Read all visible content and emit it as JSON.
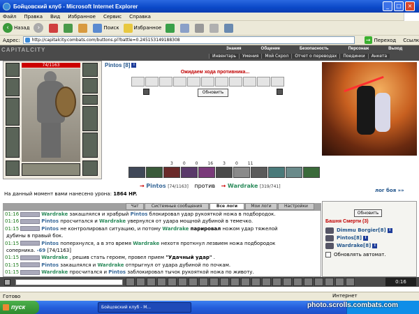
{
  "window": {
    "title": "Бойцовский клуб - Microsoft Internet Explorer"
  },
  "menu": [
    "Файл",
    "Правка",
    "Вид",
    "Избранное",
    "Сервис",
    "Справка"
  ],
  "toolbar": {
    "back": "Назад",
    "search": "Поиск",
    "favorites": "Избранное"
  },
  "address": {
    "label": "Адрес:",
    "url": "http://capitalcity.combats.com/buttons.pl?battle=0.245153149188308",
    "go": "Переход",
    "links": "Ссылки"
  },
  "site": {
    "logo": "CAPITALCITY",
    "topnav": [
      "Знания",
      "Общение",
      "Безопасность",
      "Персонаж",
      "Выход"
    ],
    "subnav": [
      "Инвентарь",
      "Умения",
      "Мой Скрол",
      "Отчет о переводах",
      "Поединки",
      "Анкета"
    ]
  },
  "player": {
    "name": "Pintos",
    "level": "[8]",
    "hp": "74/1163"
  },
  "battle": {
    "waiting": "Ожидаем хода противника...",
    "refresh": "Обновить",
    "stats": [
      "3",
      "0",
      "0",
      "16",
      "3",
      "0",
      "11"
    ],
    "p1_name": "Pintos",
    "p1_hp": "[74/1163]",
    "vs": "против",
    "p2_name": "Wardrake",
    "p2_hp": "[319/741]",
    "damage_label": "На данный момент вами нанесено урона:",
    "damage_value": "1864 HP.",
    "log_link": "лог боя »»"
  },
  "tabs": [
    "Чат",
    "Системные сообщения",
    "Все логи",
    "Мои логи",
    "Настройки"
  ],
  "chat": [
    {
      "time": "01:16",
      "parts": [
        [
          "wr",
          "Wardrake"
        ],
        [
          "",
          "закашлялся и храбрый"
        ],
        [
          "pn",
          "Pintos"
        ],
        [
          "",
          "блокировал удар рукояткой ножа в подбородок."
        ]
      ]
    },
    {
      "time": "01:16",
      "parts": [
        [
          "pn",
          "Pintos"
        ],
        [
          "",
          "просчитался и"
        ],
        [
          "wr",
          "Wardrake"
        ],
        [
          "",
          "увернулся от удара мощной дубиной в темечко."
        ]
      ]
    },
    {
      "time": "01:15",
      "parts": [
        [
          "pn",
          "Pintos"
        ],
        [
          "",
          "не контролировал ситуацию, и потому"
        ],
        [
          "wr",
          "Wardrake"
        ],
        [
          "b",
          "парировал"
        ],
        [
          "",
          "ножом удар тяжелой"
        ]
      ]
    },
    {
      "time": "",
      "parts": [
        [
          "",
          "дубины в правый бок."
        ]
      ]
    },
    {
      "time": "01:15",
      "parts": [
        [
          "pn",
          "Pintos"
        ],
        [
          "",
          "поперхнулся, а в это время"
        ],
        [
          "wr",
          "Wardrake"
        ],
        [
          "",
          "нехотя проткнул лезвием ножа подбородок"
        ]
      ]
    },
    {
      "time": "",
      "parts": [
        [
          "",
          "соперника."
        ],
        [
          "dmg",
          "-69"
        ],
        [
          "",
          "[74/1163]"
        ]
      ]
    },
    {
      "time": "01:15",
      "parts": [
        [
          "wr",
          "Wardrake"
        ],
        [
          "",
          ", решив стать героем, провел прием"
        ],
        [
          "b",
          "\"Удачный удар\""
        ],
        [
          "",
          "."
        ]
      ]
    },
    {
      "time": "01:15",
      "parts": [
        [
          "pn",
          "Pintos"
        ],
        [
          "",
          "закашлялся и"
        ],
        [
          "wr",
          "Wardrake"
        ],
        [
          "",
          "отпрыгнул от удара дубиной по почкам."
        ]
      ]
    },
    {
      "time": "01:15",
      "parts": [
        [
          "wr",
          "Wardrake"
        ],
        [
          "",
          "просчитался и"
        ],
        [
          "pn",
          "Pintos"
        ],
        [
          "",
          "заблокировал тычок рукояткой ножа по животу."
        ]
      ]
    }
  ],
  "sidebar": {
    "refresh": "Обновить",
    "tower": "Башня Смерти (3)",
    "players": [
      "Dimmu Borgier[8]",
      "Pintos[8]",
      "Wardrake[8]"
    ],
    "auto": "Обновлять автомат."
  },
  "clock": "0:16",
  "status": {
    "left": "Готово",
    "zone": "Интернет"
  },
  "taskbar": {
    "start": "пуск",
    "task": "Бойцовский клуб - M..."
  },
  "watermark": "photo.scrolls.combats.com"
}
